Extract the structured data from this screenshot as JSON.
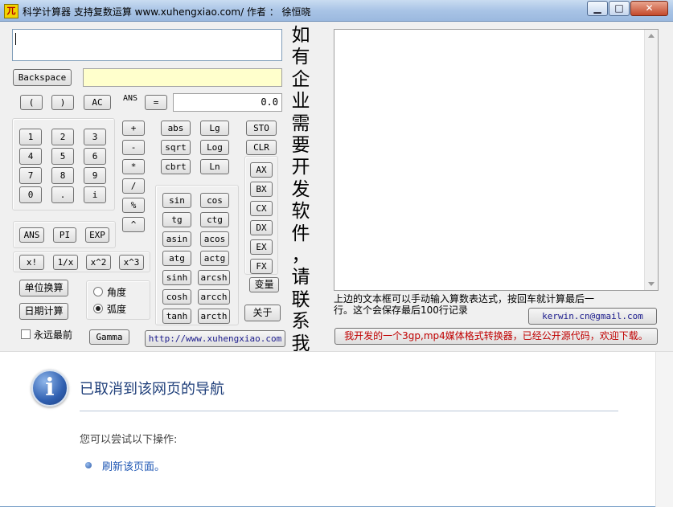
{
  "window": {
    "icon_glyph": "兀",
    "title": "科学计算器  支持复数运算 www.xuhengxiao.com/   作者 ： 徐恒晓",
    "minimize_glyph": "▁",
    "maximize_glyph": "□",
    "close_glyph": "✕"
  },
  "calculator": {
    "expression_value": "",
    "error_value": "",
    "ans_label": "ANS",
    "result_value": "0.0",
    "buttons": {
      "backspace": "Backspace",
      "lparen": "(",
      "rparen": ")",
      "ac": "AC",
      "equals": "=",
      "digits": [
        "1",
        "2",
        "3",
        "4",
        "5",
        "6",
        "7",
        "8",
        "9",
        "0",
        ".",
        "i"
      ],
      "ops": [
        "+",
        "-",
        "*",
        "/",
        "%",
        "^"
      ],
      "funcs_top": [
        "abs",
        "Lg",
        "sqrt",
        "Log",
        "cbrt",
        "Ln"
      ],
      "sto": "STO",
      "clr": "CLR",
      "regs": [
        "AX",
        "BX",
        "CX",
        "DX",
        "EX",
        "FX"
      ],
      "var": "变量",
      "trig": [
        "sin",
        "cos",
        "tg",
        "ctg",
        "asin",
        "acos",
        "atg",
        "actg",
        "sinh",
        "arcsh",
        "cosh",
        "arcch",
        "tanh",
        "arcth"
      ],
      "consts": [
        "ANS",
        "PI",
        "EXP"
      ],
      "pow": [
        "x!",
        "1/x",
        "x^2",
        "x^3"
      ],
      "unit_convert": "单位换算",
      "date_calc": "日期计算",
      "gamma": "Gamma",
      "about": "关于",
      "website": "http://www.xuhengxiao.com"
    },
    "angle_mode": {
      "degree_label": "角度",
      "radian_label": "弧度",
      "selected": "radian"
    },
    "topmost_label": "永远最前",
    "topmost_checked": false,
    "vertical_ad": "如有企业需要开发软件，请联系我"
  },
  "right_panel": {
    "history_text": "",
    "hint": "上边的文本框可以手动输入算数表达式，按回车就计算最后一行。这个会保存最后100行记录",
    "email_button": "kerwin.cn@gmail.com",
    "converter_button": "我开发的一个3gp,mp4媒体格式转换器，已经公开源代码，欢迎下载。",
    "converter_color": "#c00000",
    "email_color": "#1a1a8c"
  },
  "browser_error": {
    "title": "已取消到该网页的导航",
    "subtitle": "您可以尝试以下操作:",
    "link": "刷新该页面。",
    "icon": "info-icon",
    "icon_glyph": "i"
  }
}
